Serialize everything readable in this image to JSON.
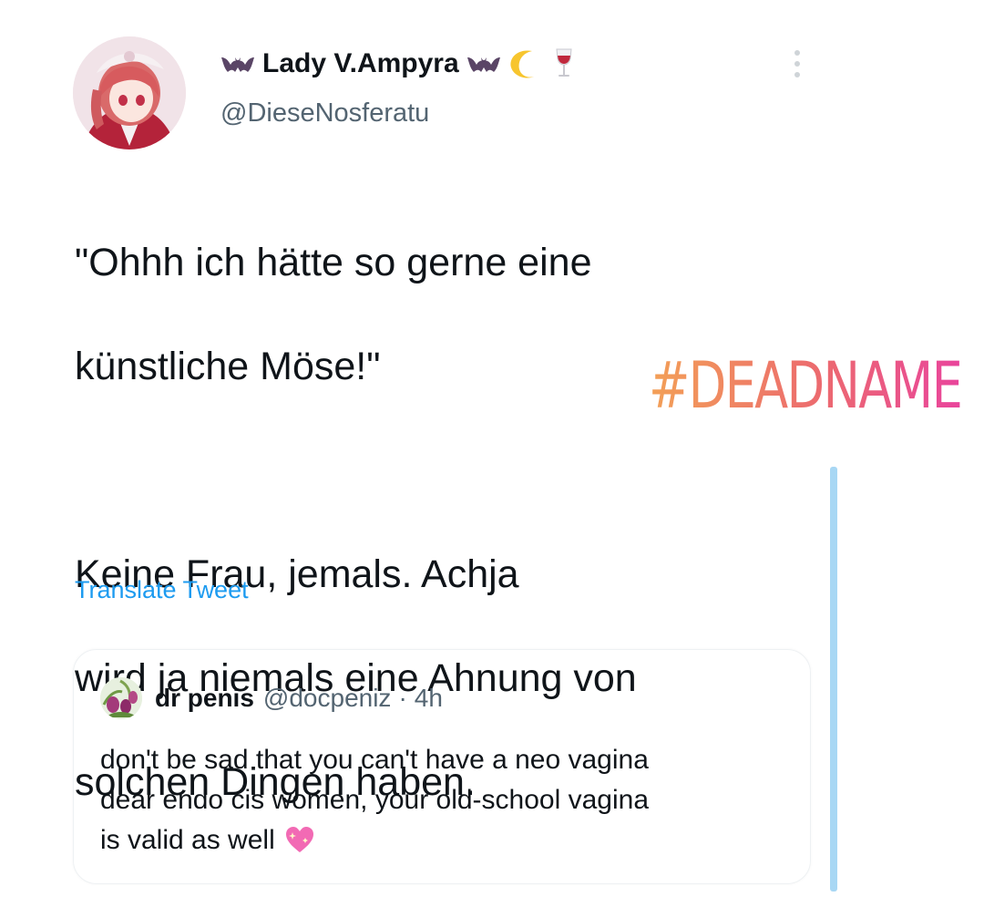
{
  "tweet": {
    "author": {
      "display_name": "Lady V.Ampyra",
      "handle": "@DieseNosferatu",
      "name_emojis": [
        "bat-icon",
        "bat-icon",
        "crescent-moon-icon",
        "wine-glass-icon"
      ]
    },
    "text_lines": [
      "\"Ohhh ich hätte so gerne eine",
      "künstliche Möse!\"",
      "",
      "Keine Frau, jemals. Achja",
      "wird ja niemals eine Ahnung von",
      "solchen Dingen haben."
    ],
    "translate_label": "Translate Tweet",
    "more_icon": "more-vertical-icon"
  },
  "overlay": {
    "hashtag": "#DEADNAME",
    "gradient_colors": [
      "#f3a056",
      "#ec6a6f",
      "#e9449c"
    ],
    "bar_color": "#a8d7f4"
  },
  "quote": {
    "display_name": "dr penis",
    "handle": "@docpeniz",
    "separator": "·",
    "time": "4h",
    "text_lines": [
      "don't be sad that you can't have a neo vagina",
      "dear endo cis women, your old-school vagina",
      "is valid as well"
    ],
    "trailing_emoji": "sparkling-heart-icon"
  },
  "colors": {
    "text": "#0f1419",
    "secondary": "#536471",
    "link": "#1d9bf0"
  }
}
